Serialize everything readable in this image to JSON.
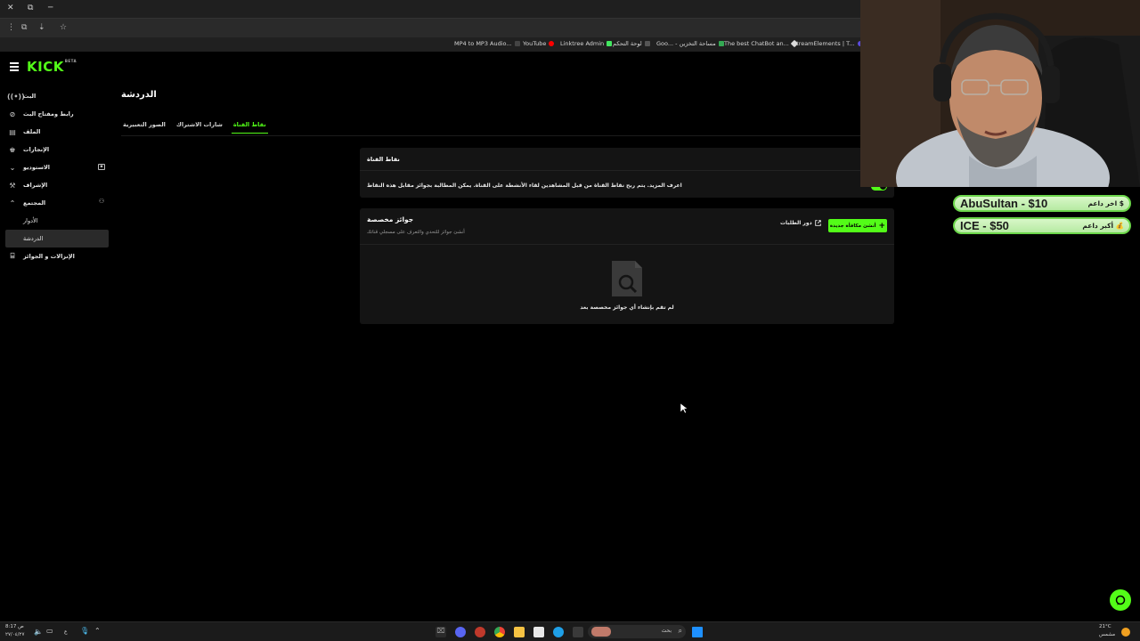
{
  "browser": {
    "bookmarks": [
      {
        "label": "MP4 to MP3 Audio...",
        "color": "#444444"
      },
      {
        "label": "YouTube",
        "color": "#ff0000"
      },
      {
        "label": "Linktree Admin",
        "color": "#43e660"
      },
      {
        "label": "لوحة التحكم",
        "color": "#555555"
      },
      {
        "label": "Goo... - مساحة التخزين",
        "color": "#34a853"
      },
      {
        "label": "The best ChatBot an...",
        "color": "#dddddd"
      },
      {
        "label": "StreamElements | T...",
        "color": "#5b4bdb"
      }
    ]
  },
  "app": {
    "logo": "KICK",
    "logo_badge": "BETA",
    "menu_icon": "hamburger-icon"
  },
  "sidebar": {
    "items": [
      {
        "label": "البث",
        "icon": "broadcast-icon"
      },
      {
        "label": "رابط ومفتاح البث",
        "icon": "link-icon"
      },
      {
        "label": "الملف",
        "icon": "profile-icon"
      },
      {
        "label": "الإنجازات",
        "icon": "trophy-icon"
      },
      {
        "label": "الاستوديو",
        "icon": "chevron-down-icon"
      },
      {
        "label": "الإشراف",
        "icon": "hammer-icon"
      },
      {
        "label": "المجتمع",
        "icon": "chevron-up-icon"
      },
      {
        "label": "الأدوار",
        "icon": ""
      },
      {
        "label": "الدردشة",
        "icon": ""
      },
      {
        "label": "الإنزالات و الجوائز",
        "icon": "gift-icon"
      }
    ]
  },
  "main": {
    "title": "الدردشة",
    "tabs": [
      {
        "label": "الصور التعبيرية",
        "active": false
      },
      {
        "label": "شارات الاشتراك",
        "active": false
      },
      {
        "label": "نقاط القناة",
        "active": true
      }
    ],
    "channel_points": {
      "header": "نقاط القناة",
      "description": "اعرف المزيد. يتم ربح نقاط القناة من قبل المشاهدين لقاء الأنشطة على القناة. يمكن المطالبة بجوائز مقابل هذه النقاط",
      "enabled": true
    },
    "rewards": {
      "title": "جوائز مخصصة",
      "subtitle": "أنشئ جوائز للتحدي والتعرف على مسجلي قناتك",
      "orders_button": "دور الطلبات",
      "new_button": "أنشئ مكافأة جديدة",
      "empty_text": "لم تقم بإنشاء أي جوائز مخصصة بعد"
    }
  },
  "overlay": {
    "last_supporter_label": "اخر داعم",
    "last_supporter_value": "AbuSultan - $10",
    "top_supporter_label": "أكبر داعم",
    "top_supporter_value": "ICE - $50"
  },
  "taskbar": {
    "search_placeholder": "بحث",
    "clock_time": "8:17 ص",
    "clock_date": "٢٧/٠٤/٢٧",
    "weather": "21°C",
    "weather_desc": "مشمس",
    "lang": "ع"
  },
  "colors": {
    "accent": "#53fc18",
    "background": "#000000",
    "card": "#141414"
  }
}
